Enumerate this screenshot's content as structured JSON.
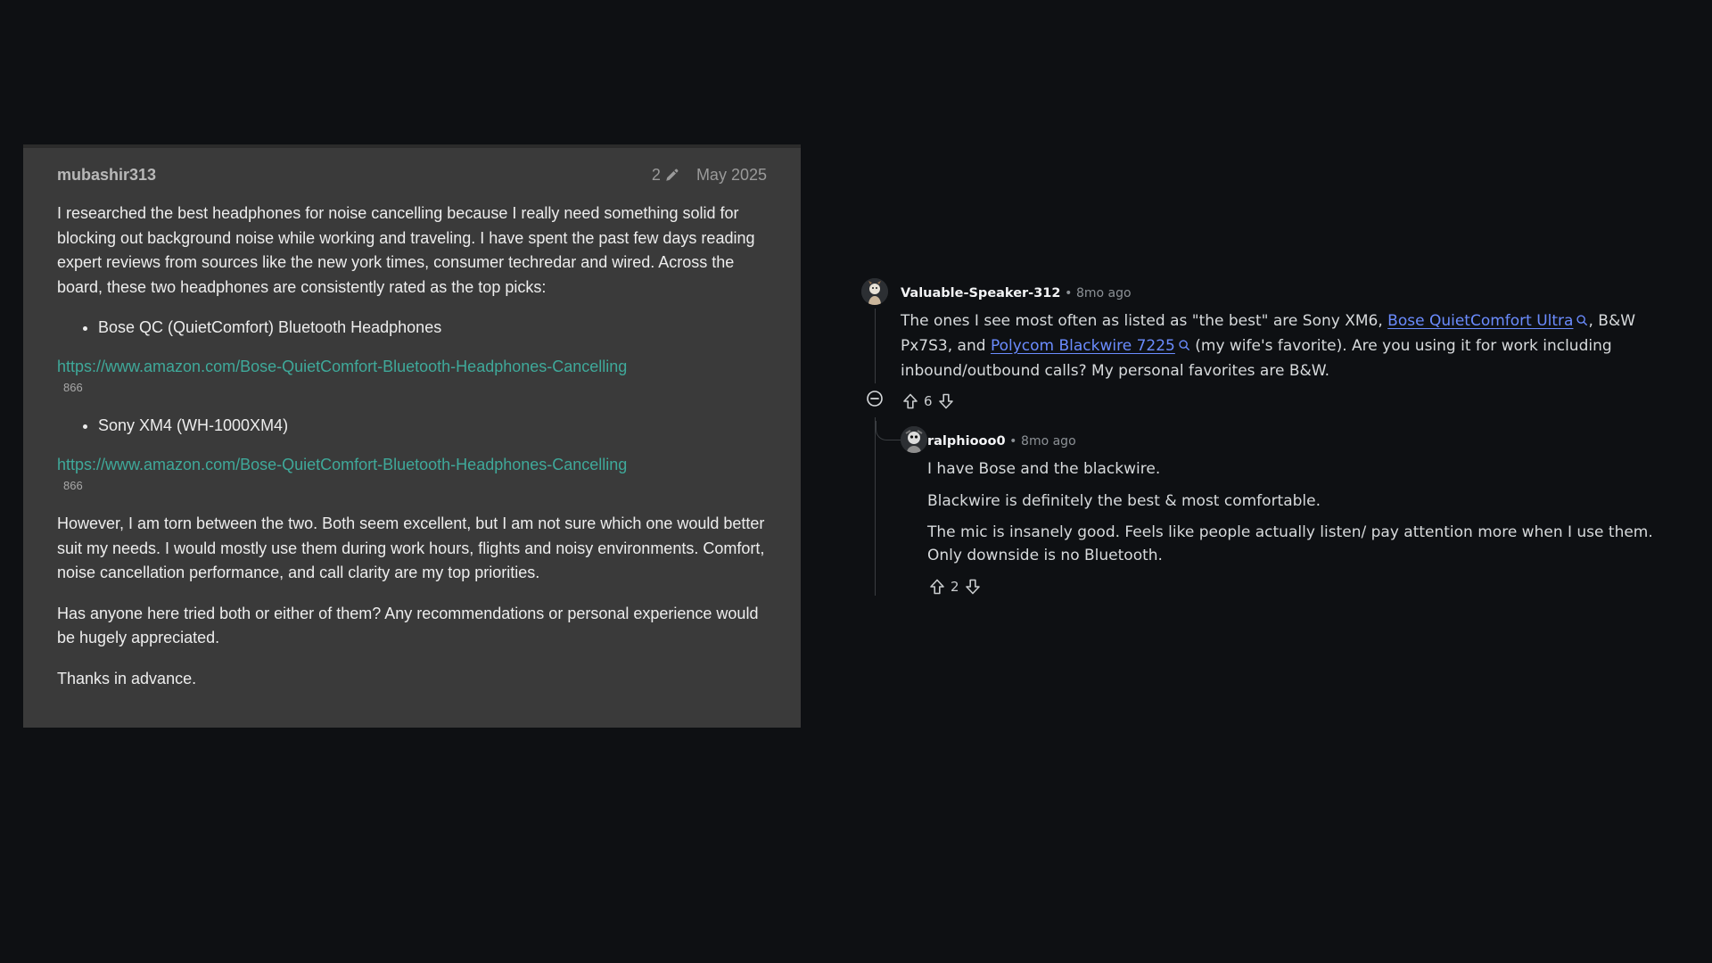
{
  "post": {
    "author": "mubashir313",
    "edit_count": "2",
    "date": "May 2025",
    "intro": "I researched the best headphones for noise cancelling because I really need something solid for blocking out background noise while working and traveling. I have spent the past few days reading expert reviews from sources like the new york times, consumer techredar and wired. Across the board, these two headphones are consistently rated as the top picks:",
    "item1": "Bose QC (QuietComfort) Bluetooth Headphones",
    "link1": "https://www.amazon.com/Bose-QuietComfort-Bluetooth-Headphones-Cancelling",
    "link1_clicks": "866",
    "item2": "Sony XM4 (WH-1000XM4)",
    "link2": "https://www.amazon.com/Bose-QuietComfort-Bluetooth-Headphones-Cancelling",
    "link2_clicks": "866",
    "para2": "However, I am torn between the two. Both seem excellent, but I am not sure which one would better suit my needs. I would mostly use them during work hours, flights and noisy environments. Comfort, noise cancellation performance, and call clarity are my top priorities.",
    "para3": "Has anyone here tried both or either of them? Any recommendations or personal experience would be hugely appreciated.",
    "para4": "Thanks in advance."
  },
  "comment1": {
    "author": "Valuable-Speaker-312",
    "dot": "•",
    "time": "8mo ago",
    "text_a": "The ones I see most often as listed as \"the best\" are Sony XM6, ",
    "link_a": "Bose QuietComfort Ultra",
    "text_b": ", B&W Px7S3, and ",
    "link_b": "Polycom Blackwire 7225",
    "text_c": " (my wife's favorite). Are you using it for work including inbound/outbound calls? My personal favorites are B&W.",
    "votes": "6"
  },
  "comment2": {
    "author": "ralphiooo0",
    "dot": "•",
    "time": "8mo ago",
    "p1": "I have Bose and the blackwire.",
    "p2": "Blackwire is definitely the best & most comfortable.",
    "p3": "The mic is insanely good. Feels like people actually listen/ pay attention more when I use them. Only downside is no Bluetooth.",
    "votes": "2"
  },
  "colors": {
    "background": "#0e1013",
    "post_bg": "#3a3a3a",
    "post_link": "#3fa99a",
    "comment_link": "#6b8cff"
  },
  "icons": [
    "pencil-icon",
    "search-icon",
    "upvote-icon",
    "downvote-icon",
    "collapse-icon",
    "avatar"
  ]
}
